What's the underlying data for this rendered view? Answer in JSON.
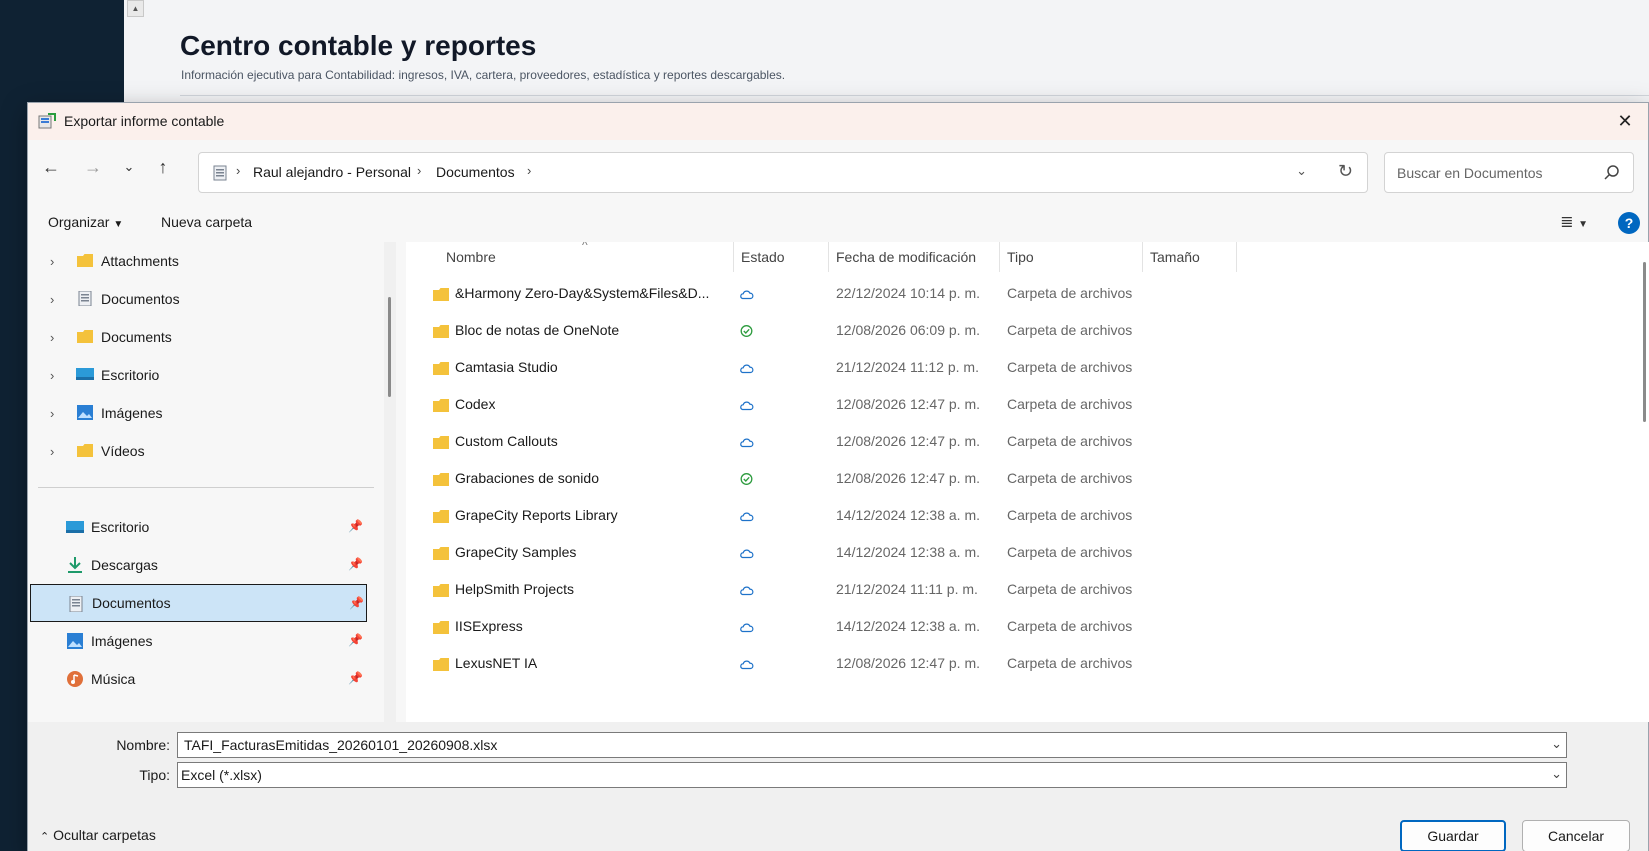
{
  "background": {
    "page_title": "Centro contable y reportes",
    "page_subtitle": "Información ejecutiva para Contabilidad: ingresos, IVA, cartera, proveedores, estadística y reportes descargables."
  },
  "dialog": {
    "title": "Exportar informe contable",
    "close_icon": "close-icon"
  },
  "navigation": {
    "back_icon": "arrow-left-icon",
    "forward_icon": "arrow-right-icon",
    "recent_icon": "chevron-down-icon",
    "up_icon": "arrow-up-icon",
    "breadcrumb": [
      "Raul alejandro - Personal",
      "Documentos"
    ],
    "search_placeholder": "Buscar en Documentos"
  },
  "commands": {
    "organize": "Organizar",
    "new_folder": "Nueva carpeta"
  },
  "nav_tree": [
    {
      "label": "Attachments",
      "icon": "folder-icon"
    },
    {
      "label": "Documentos",
      "icon": "documents-icon"
    },
    {
      "label": "Documents",
      "icon": "folder-icon"
    },
    {
      "label": "Escritorio",
      "icon": "desktop-icon"
    },
    {
      "label": "Imágenes",
      "icon": "pictures-icon"
    },
    {
      "label": "Vídeos",
      "icon": "folder-icon"
    }
  ],
  "quick_access": [
    {
      "label": "Escritorio",
      "icon": "desktop-icon"
    },
    {
      "label": "Descargas",
      "icon": "download-icon"
    },
    {
      "label": "Documentos",
      "icon": "documents-icon",
      "selected": true
    },
    {
      "label": "Imágenes",
      "icon": "pictures-icon"
    },
    {
      "label": "Música",
      "icon": "music-icon"
    }
  ],
  "columns": {
    "name": "Nombre",
    "status": "Estado",
    "modified": "Fecha de modificación",
    "type": "Tipo",
    "size": "Tamaño"
  },
  "files": [
    {
      "name": "&Harmony Zero-Day&System&Files&D...",
      "status": "cloud",
      "modified": "22/12/2024 10:14 p. m.",
      "type": "Carpeta de archivos"
    },
    {
      "name": "Bloc de notas de OneNote",
      "status": "synced",
      "modified": "12/08/2026 06:09 p. m.",
      "type": "Carpeta de archivos"
    },
    {
      "name": "Camtasia Studio",
      "status": "cloud",
      "modified": "21/12/2024 11:12 p. m.",
      "type": "Carpeta de archivos"
    },
    {
      "name": "Codex",
      "status": "cloud",
      "modified": "12/08/2026 12:47 p. m.",
      "type": "Carpeta de archivos"
    },
    {
      "name": "Custom Callouts",
      "status": "cloud",
      "modified": "12/08/2026 12:47 p. m.",
      "type": "Carpeta de archivos"
    },
    {
      "name": "Grabaciones de sonido",
      "status": "synced",
      "modified": "12/08/2026 12:47 p. m.",
      "type": "Carpeta de archivos"
    },
    {
      "name": "GrapeCity Reports Library",
      "status": "cloud",
      "modified": "14/12/2024 12:38 a. m.",
      "type": "Carpeta de archivos"
    },
    {
      "name": "GrapeCity Samples",
      "status": "cloud",
      "modified": "14/12/2024 12:38 a. m.",
      "type": "Carpeta de archivos"
    },
    {
      "name": "HelpSmith Projects",
      "status": "cloud",
      "modified": "21/12/2024 11:11 p. m.",
      "type": "Carpeta de archivos"
    },
    {
      "name": "IISExpress",
      "status": "cloud",
      "modified": "14/12/2024 12:38 a. m.",
      "type": "Carpeta de archivos"
    },
    {
      "name": "LexusNET IA",
      "status": "cloud",
      "modified": "12/08/2026 12:47 p. m.",
      "type": "Carpeta de archivos"
    }
  ],
  "save": {
    "name_label": "Nombre:",
    "name_value": "TAFI_FacturasEmitidas_20260101_20260908.xlsx",
    "type_label": "Tipo:",
    "type_value": "Excel (*.xlsx)",
    "hide_folders": "Ocultar carpetas",
    "save_button": "Guardar",
    "cancel_button": "Cancelar"
  },
  "colors": {
    "accent": "#0067c0",
    "selection": "#cce4f7",
    "folder": "#f4c23b",
    "cloud": "#1e72c9",
    "synced": "#2e9c3f"
  }
}
